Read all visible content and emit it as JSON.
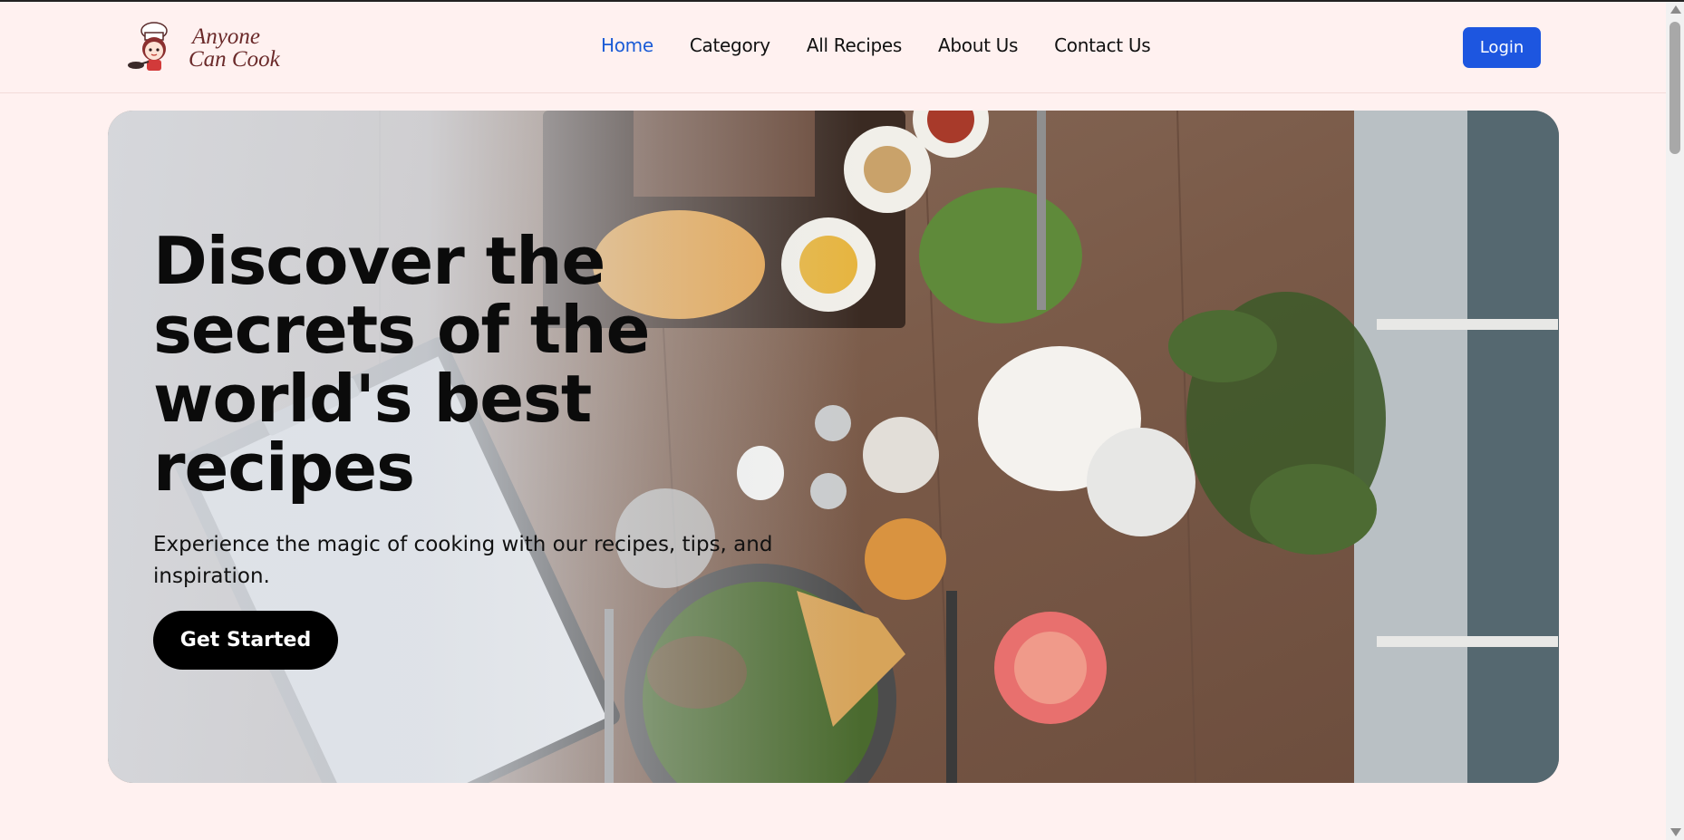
{
  "brand": {
    "line1": "Anyone",
    "line2": "Can Cook",
    "logo_icon": "chef-girl-mascot-icon"
  },
  "nav": [
    {
      "label": "Home",
      "active": true
    },
    {
      "label": "Category",
      "active": false
    },
    {
      "label": "All Recipes",
      "active": false
    },
    {
      "label": "About Us",
      "active": false
    },
    {
      "label": "Contact Us",
      "active": false
    }
  ],
  "header": {
    "login_label": "Login"
  },
  "hero": {
    "title": "Discover the secrets of the world's best recipes",
    "subtitle": "Experience the magic of cooking with our recipes, tips, and inspiration.",
    "cta_label": "Get Started",
    "image_subject": "overhead-restaurant-table-photo"
  },
  "colors": {
    "accent": "#1d56e0",
    "background": "#fff1f0",
    "active_nav": "#1a5bd6",
    "cta": "#000000"
  }
}
